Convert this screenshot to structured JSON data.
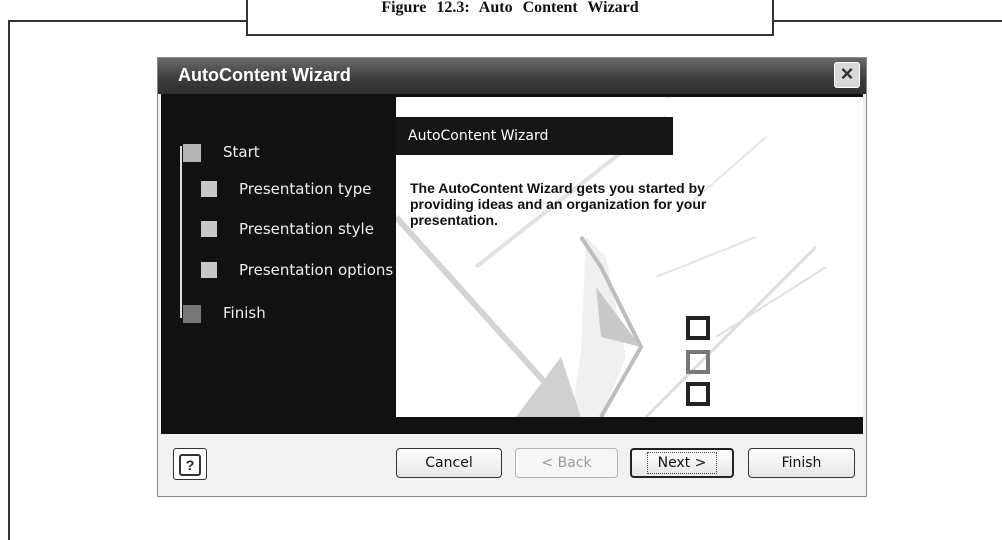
{
  "figure": {
    "caption": "Figure 12.3: Auto Content Wizard"
  },
  "dialog": {
    "title": "AutoContent Wizard",
    "close_icon": "close-icon",
    "steps": [
      {
        "label": "Start"
      },
      {
        "label": "Presentation type"
      },
      {
        "label": "Presentation style"
      },
      {
        "label": "Presentation options"
      },
      {
        "label": "Finish"
      }
    ],
    "panel": {
      "header": "AutoContent Wizard",
      "description": "The AutoContent Wizard gets you started by providing ideas and an organization for your presentation."
    },
    "buttons": {
      "help_icon": "help-icon",
      "help": "?",
      "cancel": "Cancel",
      "back": "< Back",
      "next": "Next >",
      "finish": "Finish"
    }
  },
  "colors": {
    "titlebar": "#3b3b3b",
    "steps_background": "#111111",
    "panel_background": "#ffffff"
  }
}
